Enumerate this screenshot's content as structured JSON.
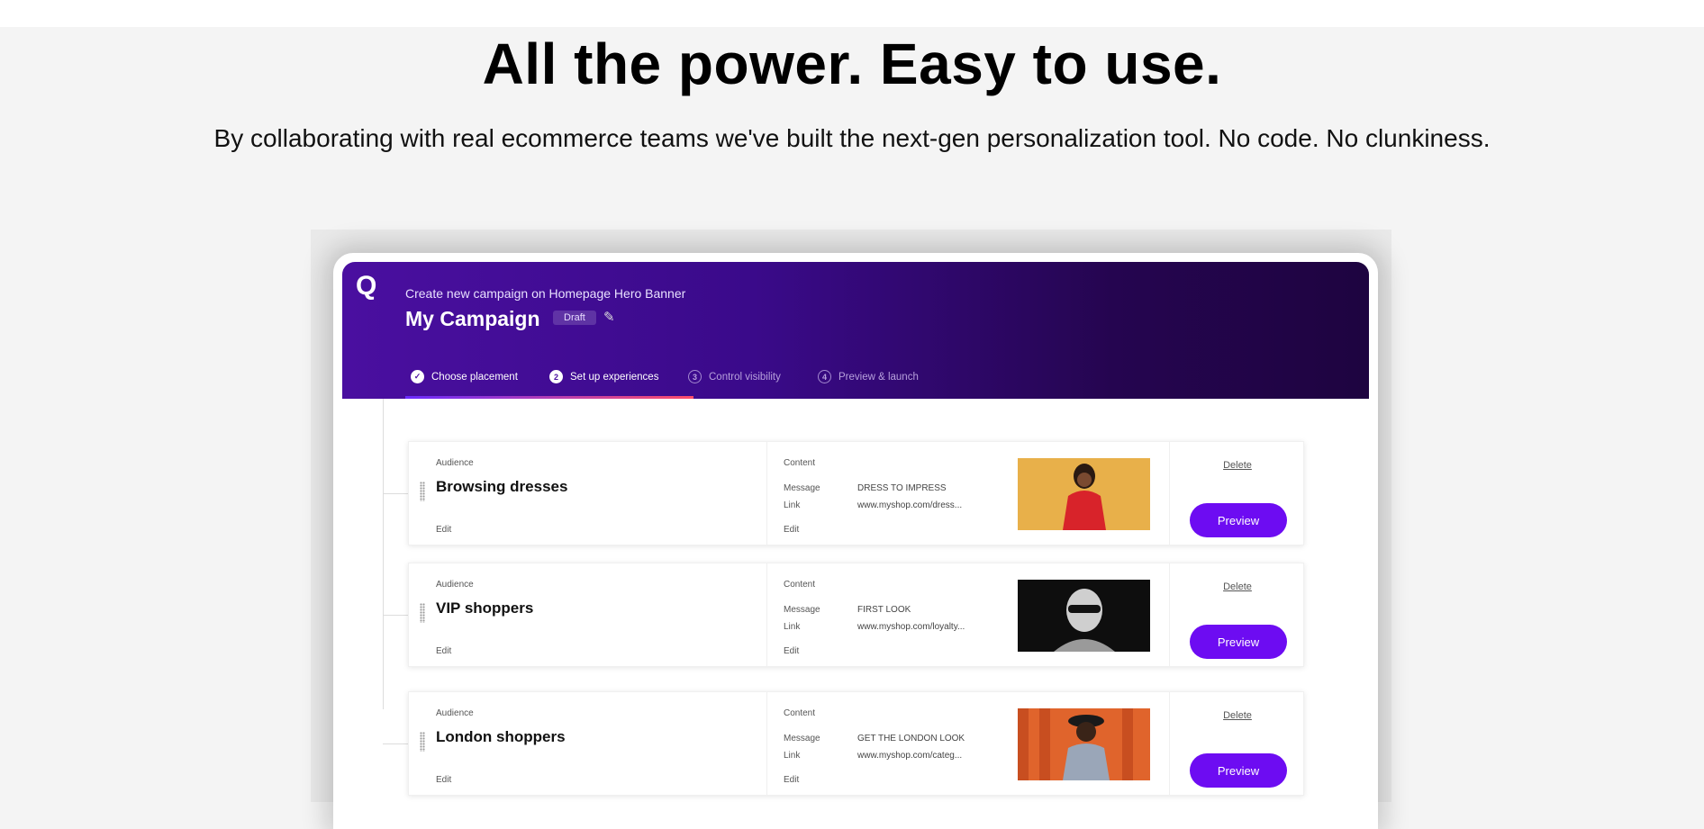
{
  "hero": {
    "headline": "All the power. Easy to use.",
    "subheadline": "By collaborating with real ecommerce teams we've built the next-gen personalization tool. No code. No clunkiness."
  },
  "app": {
    "logo": "Q",
    "breadcrumb": "Create new campaign on Homepage Hero Banner",
    "campaign_title": "My Campaign",
    "status_badge": "Draft",
    "steps": [
      {
        "number": "✓",
        "label": "Choose placement",
        "state": "done"
      },
      {
        "number": "2",
        "label": "Set up experiences",
        "state": "active"
      },
      {
        "number": "3",
        "label": "Control visibility",
        "state": "todo"
      },
      {
        "number": "4",
        "label": "Preview & launch",
        "state": "todo"
      }
    ],
    "column_labels": {
      "audience": "Audience",
      "content": "Content",
      "message": "Message",
      "link": "Link",
      "edit": "Edit",
      "delete": "Delete",
      "preview": "Preview"
    },
    "experiences": [
      {
        "audience": "Browsing dresses",
        "message": "DRESS TO IMPRESS",
        "link": "www.myshop.com/dress...",
        "thumb_color": "#e8b04a"
      },
      {
        "audience": "VIP shoppers",
        "message": "FIRST LOOK",
        "link": "www.myshop.com/loyalty...",
        "thumb_color": "#1a1a1a"
      },
      {
        "audience": "London shoppers",
        "message": "GET THE LONDON LOOK",
        "link": "www.myshop.com/categ...",
        "thumb_color": "#e0642c"
      }
    ]
  },
  "colors": {
    "accent": "#6d0cf2",
    "header_start": "#4a0fa0",
    "header_end": "#1e0440"
  }
}
